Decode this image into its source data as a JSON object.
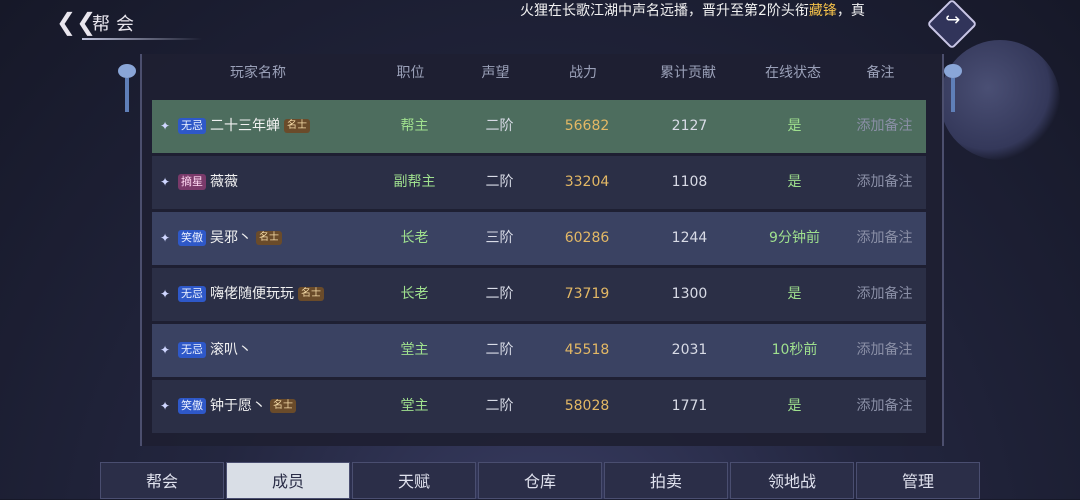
{
  "title": "帮会",
  "ticker": {
    "before": "火狸在长歌江湖中声名远播，晋升至第2阶头衔",
    "highlight": "藏锋",
    "after": "，真"
  },
  "columns": [
    "玩家名称",
    "职位",
    "声望",
    "战力",
    "累计贡献",
    "在线状态",
    "备注"
  ],
  "members": [
    {
      "tag": "无忌",
      "tag_color": "blue",
      "name": "二十三年蝉",
      "badge": "名士",
      "position": "帮主",
      "fame": "二阶",
      "power": "56682",
      "contribution": "2127",
      "online": "是",
      "note": "添加备注"
    },
    {
      "tag": "摘星",
      "tag_color": "pink",
      "name": "薇薇",
      "badge": "",
      "position": "副帮主",
      "fame": "二阶",
      "power": "33204",
      "contribution": "1108",
      "online": "是",
      "note": "添加备注"
    },
    {
      "tag": "笑傲",
      "tag_color": "blue",
      "name": "吴邪丶",
      "badge": "名士",
      "position": "长老",
      "fame": "三阶",
      "power": "60286",
      "contribution": "1244",
      "online": "9分钟前",
      "note": "添加备注"
    },
    {
      "tag": "无忌",
      "tag_color": "blue",
      "name": "嗨佬随便玩玩",
      "badge": "名士",
      "position": "长老",
      "fame": "二阶",
      "power": "73719",
      "contribution": "1300",
      "online": "是",
      "note": "添加备注"
    },
    {
      "tag": "无忌",
      "tag_color": "blue",
      "name": "滚叭丶",
      "badge": "",
      "position": "堂主",
      "fame": "二阶",
      "power": "45518",
      "contribution": "2031",
      "online": "10秒前",
      "note": "添加备注"
    },
    {
      "tag": "笑傲",
      "tag_color": "blue",
      "name": "钟于愿丶",
      "badge": "名士",
      "position": "堂主",
      "fame": "二阶",
      "power": "58028",
      "contribution": "1771",
      "online": "是",
      "note": "添加备注"
    }
  ],
  "tabs": [
    "帮会",
    "成员",
    "天赋",
    "仓库",
    "拍卖",
    "领地战",
    "管理"
  ],
  "active_tab": 1
}
